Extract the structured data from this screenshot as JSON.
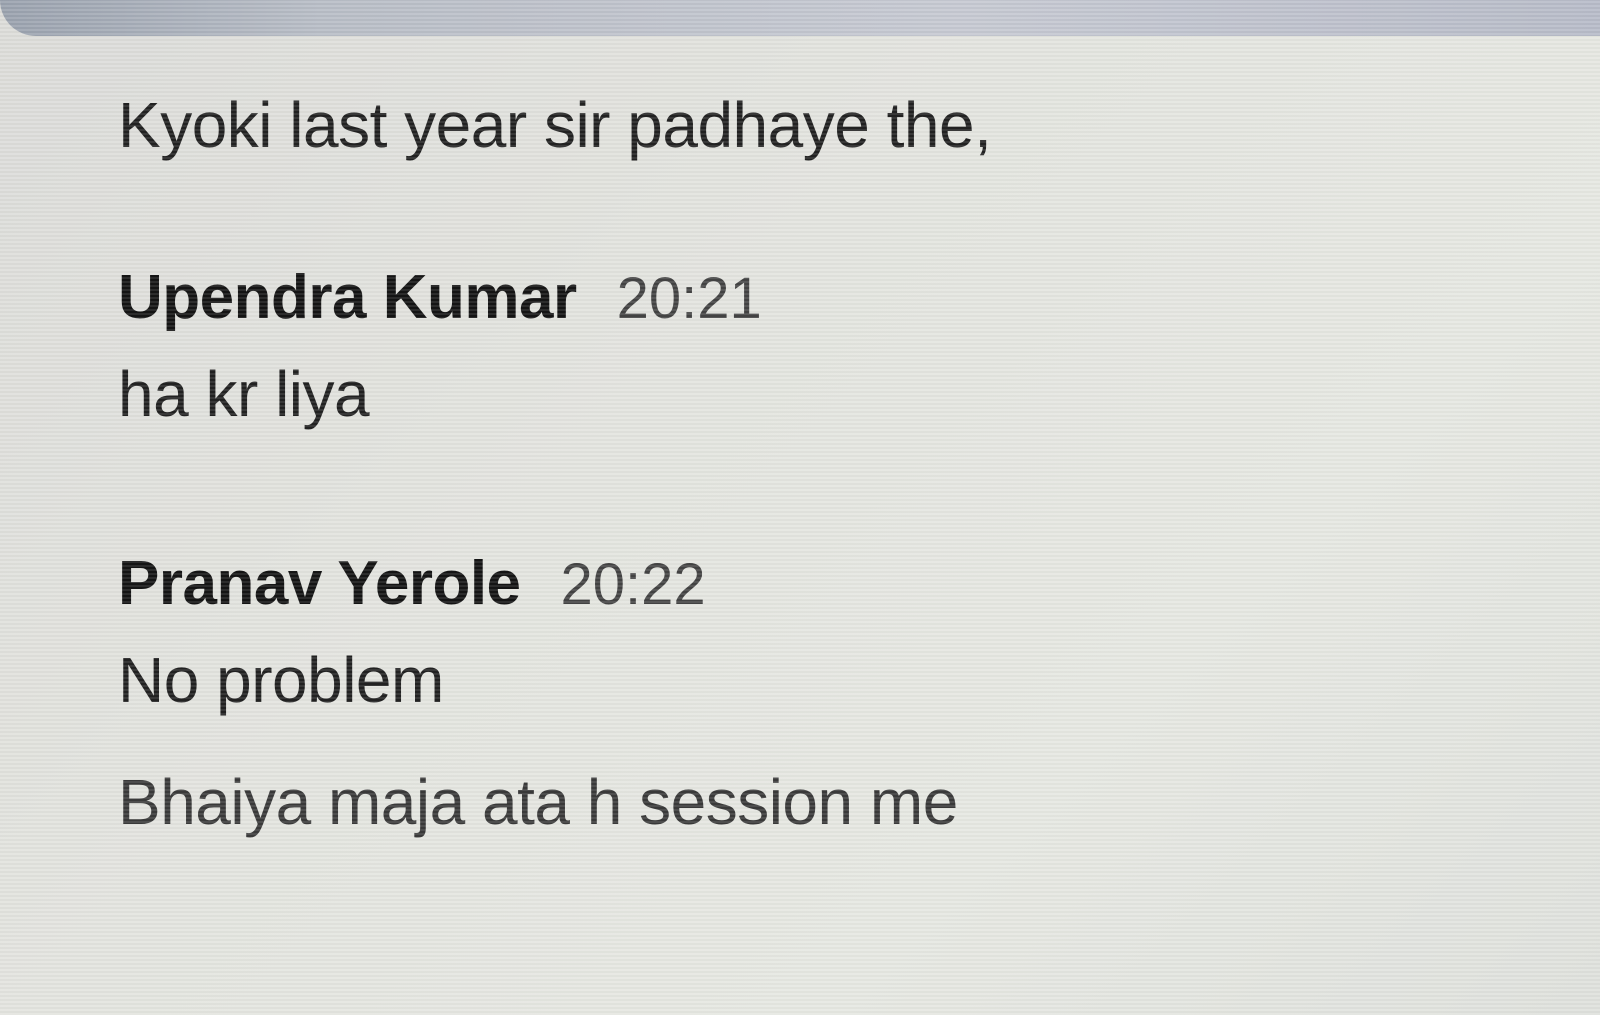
{
  "chat": {
    "first_message": "Kyoki last year sir padhaye the,",
    "groups": [
      {
        "sender": "Upendra Kumar",
        "time": "20:21",
        "messages": [
          "ha kr liya"
        ]
      },
      {
        "sender": "Pranav Yerole",
        "time": "20:22",
        "messages": [
          "No problem",
          "Bhaiya maja ata h session me"
        ]
      }
    ]
  }
}
